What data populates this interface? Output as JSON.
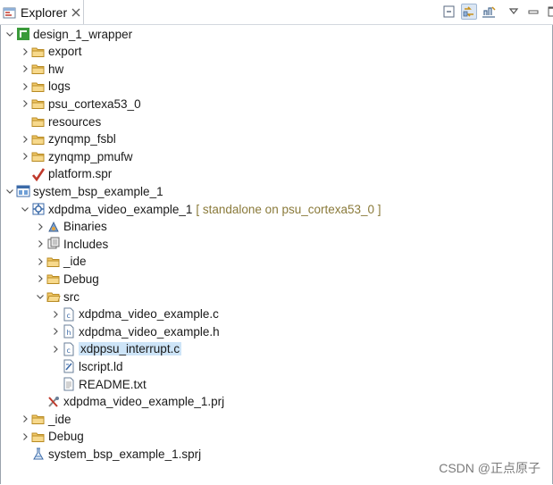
{
  "tab": {
    "title": "Explorer",
    "close": "close-icon"
  },
  "toolbar": [
    "collapse-all-icon",
    "link-editor-icon",
    "filter-icon",
    "view-menu-icon",
    "minimize-icon",
    "maximize-icon"
  ],
  "tree": [
    {
      "label": "design_1_wrapper",
      "indent": 0,
      "chevron": "down",
      "icon": "platform-project-icon"
    },
    {
      "label": "export",
      "indent": 1,
      "chevron": "right",
      "icon": "folder-icon"
    },
    {
      "label": "hw",
      "indent": 1,
      "chevron": "right",
      "icon": "folder-icon"
    },
    {
      "label": "logs",
      "indent": 1,
      "chevron": "right",
      "icon": "folder-icon"
    },
    {
      "label": "psu_cortexa53_0",
      "indent": 1,
      "chevron": "right",
      "icon": "folder-icon"
    },
    {
      "label": "resources",
      "indent": 1,
      "chevron": "none",
      "icon": "folder-icon"
    },
    {
      "label": "zynqmp_fsbl",
      "indent": 1,
      "chevron": "right",
      "icon": "folder-icon"
    },
    {
      "label": "zynqmp_pmufw",
      "indent": 1,
      "chevron": "right",
      "icon": "folder-icon"
    },
    {
      "label": "platform.spr",
      "indent": 1,
      "chevron": "none",
      "icon": "spr-file-icon"
    },
    {
      "label": "system_bsp_example_1",
      "indent": 0,
      "chevron": "down",
      "icon": "system-project-icon"
    },
    {
      "label": "xdpdma_video_example_1",
      "decoration": "[ standalone on psu_cortexa53_0 ]",
      "indent": 1,
      "chevron": "down",
      "icon": "application-project-icon"
    },
    {
      "label": "Binaries",
      "indent": 2,
      "chevron": "right",
      "icon": "binaries-icon"
    },
    {
      "label": "Includes",
      "indent": 2,
      "chevron": "right",
      "icon": "includes-icon"
    },
    {
      "label": "_ide",
      "indent": 2,
      "chevron": "right",
      "icon": "folder-icon"
    },
    {
      "label": "Debug",
      "indent": 2,
      "chevron": "right",
      "icon": "folder-icon"
    },
    {
      "label": "src",
      "indent": 2,
      "chevron": "down",
      "icon": "source-folder-icon"
    },
    {
      "label": "xdpdma_video_example.c",
      "indent": 3,
      "chevron": "right",
      "icon": "c-file-icon"
    },
    {
      "label": "xdpdma_video_example.h",
      "indent": 3,
      "chevron": "right",
      "icon": "h-file-icon"
    },
    {
      "label": "xdppsu_interrupt.c",
      "indent": 3,
      "chevron": "right",
      "icon": "c-file-icon",
      "selected": true
    },
    {
      "label": "lscript.ld",
      "indent": 3,
      "chevron": "none",
      "icon": "linker-script-icon"
    },
    {
      "label": "README.txt",
      "indent": 3,
      "chevron": "none",
      "icon": "text-file-icon"
    },
    {
      "label": "xdpdma_video_example_1.prj",
      "indent": 2,
      "chevron": "none",
      "icon": "prj-file-icon"
    },
    {
      "label": "_ide",
      "indent": 1,
      "chevron": "right",
      "icon": "folder-icon"
    },
    {
      "label": "Debug",
      "indent": 1,
      "chevron": "right",
      "icon": "folder-icon"
    },
    {
      "label": "system_bsp_example_1.sprj",
      "indent": 1,
      "chevron": "none",
      "icon": "sprj-file-icon"
    }
  ],
  "watermark": "CSDN @正点原子"
}
